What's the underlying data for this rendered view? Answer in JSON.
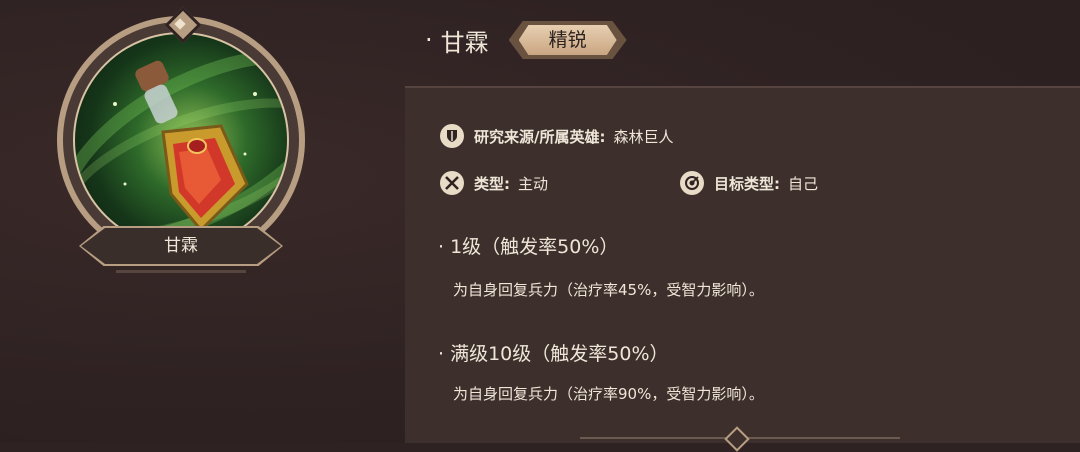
{
  "skill": {
    "name": "甘霖",
    "rank": "精锐",
    "icon": "potion-icon"
  },
  "emblem": {
    "label": "甘霖"
  },
  "info": {
    "source_label": "研究来源/所属英雄:",
    "source_value": "森林巨人",
    "type_label": "类型:",
    "type_value": "主动",
    "target_label": "目标类型:",
    "target_value": "自己"
  },
  "levels": [
    {
      "title": "1级（触发率50%）",
      "desc": "为自身回复兵力（治疗率45%，受智力影响）。"
    },
    {
      "title": "满级10级（触发率50%）",
      "desc": "为自身回复兵力（治疗率90%，受智力影响）。"
    }
  ],
  "colors": {
    "background": "#2f2222",
    "panel": "#3c2f2c",
    "accent_gold": "#b79e82",
    "text": "#efe6d8"
  }
}
